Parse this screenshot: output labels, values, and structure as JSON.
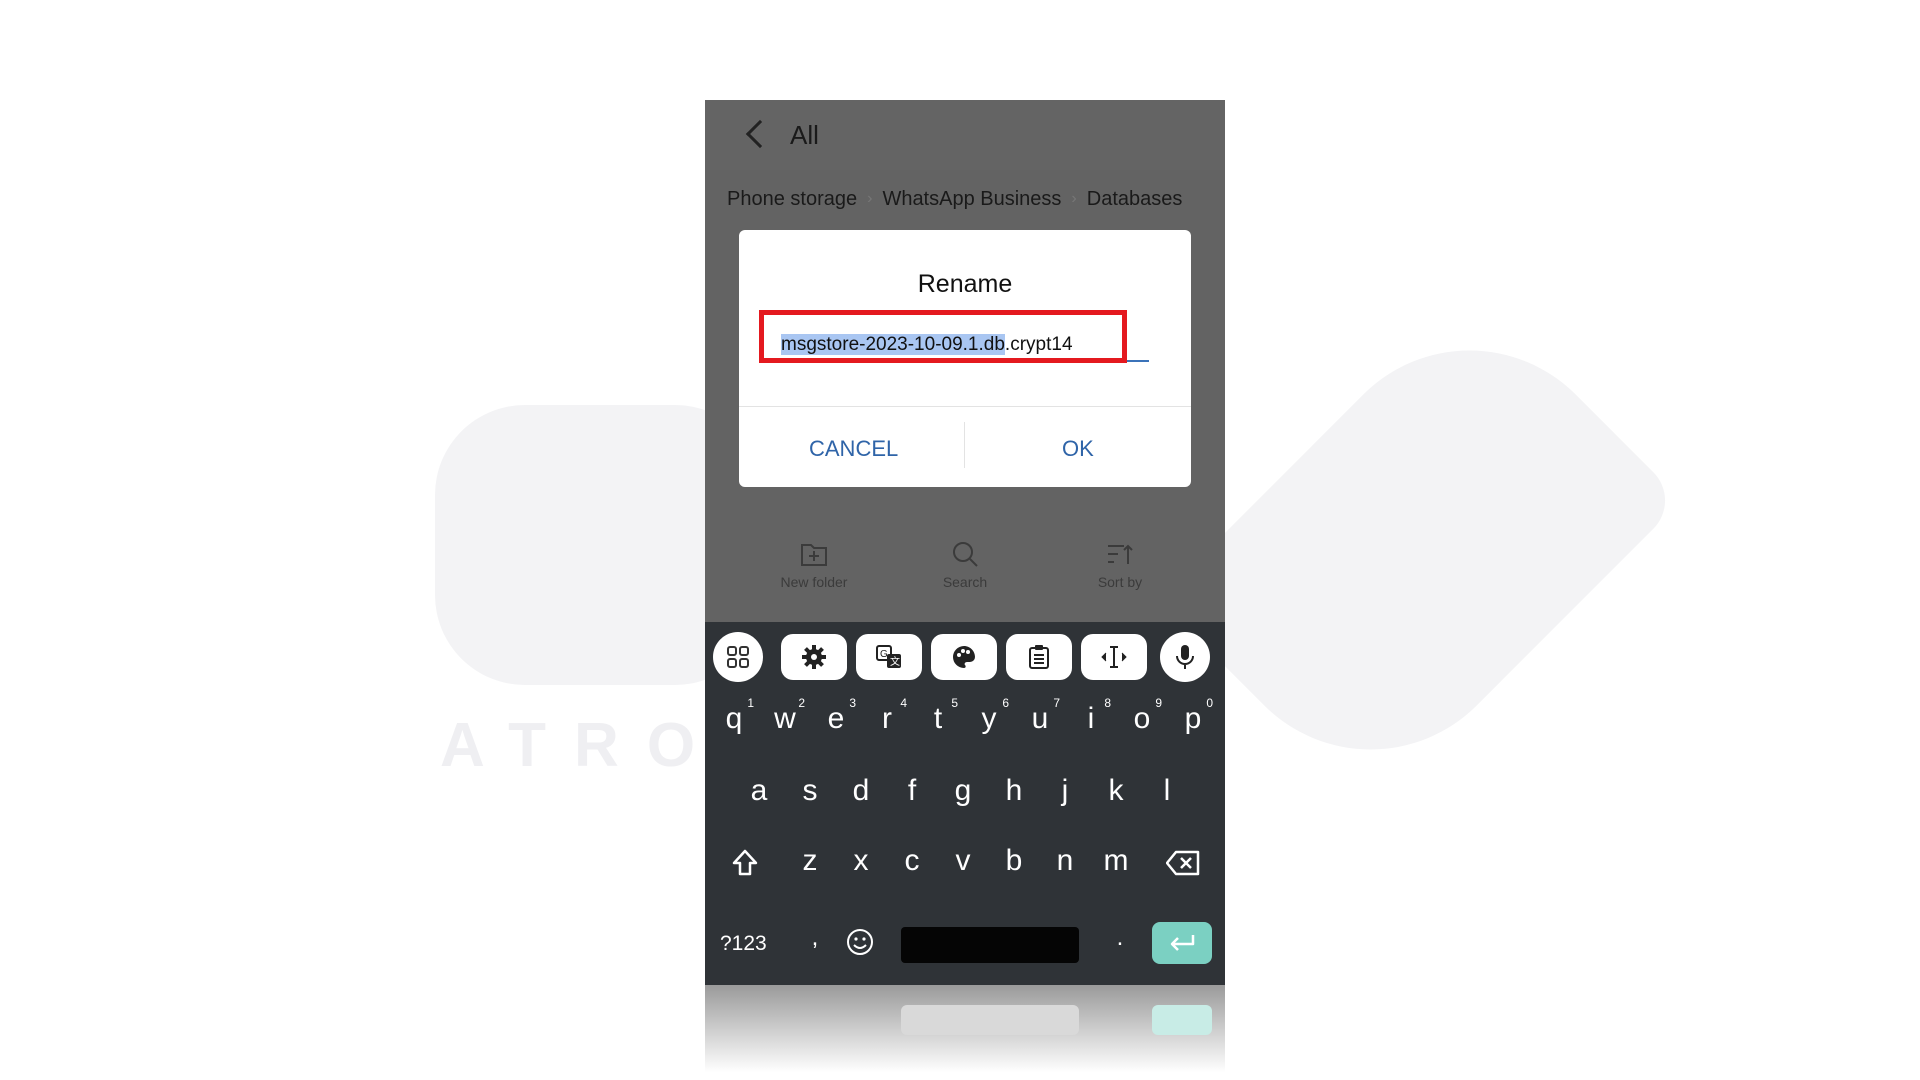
{
  "watermark": {
    "text": "ATRO"
  },
  "header": {
    "title": "All"
  },
  "breadcrumb": [
    "Phone storage",
    "WhatsApp Business",
    "Databases"
  ],
  "dialog": {
    "title": "Rename",
    "filename_selected": "msgstore-2023-10-09.1.db",
    "filename_rest": ".crypt14",
    "cancel_label": "CANCEL",
    "ok_label": "OK"
  },
  "tools": {
    "new_folder": "New folder",
    "search": "Search",
    "sort_by": "Sort by"
  },
  "keyboard": {
    "row1": [
      {
        "k": "q",
        "n": "1"
      },
      {
        "k": "w",
        "n": "2"
      },
      {
        "k": "e",
        "n": "3"
      },
      {
        "k": "r",
        "n": "4"
      },
      {
        "k": "t",
        "n": "5"
      },
      {
        "k": "y",
        "n": "6"
      },
      {
        "k": "u",
        "n": "7"
      },
      {
        "k": "i",
        "n": "8"
      },
      {
        "k": "o",
        "n": "9"
      },
      {
        "k": "p",
        "n": "0"
      }
    ],
    "row2": [
      "a",
      "s",
      "d",
      "f",
      "g",
      "h",
      "j",
      "k",
      "l"
    ],
    "row3": [
      "z",
      "x",
      "c",
      "v",
      "b",
      "n",
      "m"
    ],
    "mode_key": "?123",
    "comma": ",",
    "period": "."
  },
  "colors": {
    "highlight_border": "#e4191f",
    "selection": "#a9c6f2",
    "accent": "#2f64a8",
    "enter": "#7bd0c2"
  }
}
